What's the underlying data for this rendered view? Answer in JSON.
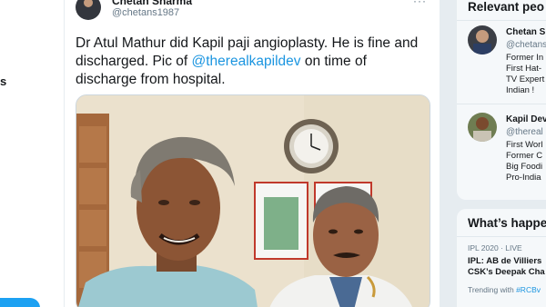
{
  "nav": {
    "fragment": "s"
  },
  "tweet": {
    "author": "Chetan Sharma",
    "handle": "@chetans1987",
    "text_before": "Dr Atul Mathur did Kapil paji angioplasty. He is fine and discharged. Pic of ",
    "mention": "@therealkapildev",
    "text_after": " on time of discharge from hospital.",
    "more": "···"
  },
  "sidebar": {
    "relevant_title": "Relevant peo",
    "people": [
      {
        "name": "Chetan S",
        "handle": "@chetans",
        "bio": [
          "Former In",
          "First Hat-",
          "TV Expert",
          "Indian !"
        ]
      },
      {
        "name": "Kapil Dev",
        "handle": "@thereal",
        "bio": [
          "First Worl",
          "Former C",
          "Big Foodi",
          "Pro-India"
        ]
      }
    ],
    "happening_title": "What’s happe",
    "trend": {
      "meta": "IPL 2020 · LIVE",
      "line1": "IPL: AB de Villiers",
      "line2": "CSK’s Deepak Cha",
      "trending_prefix": "Trending with ",
      "trending_tag": "#RCBv"
    }
  }
}
